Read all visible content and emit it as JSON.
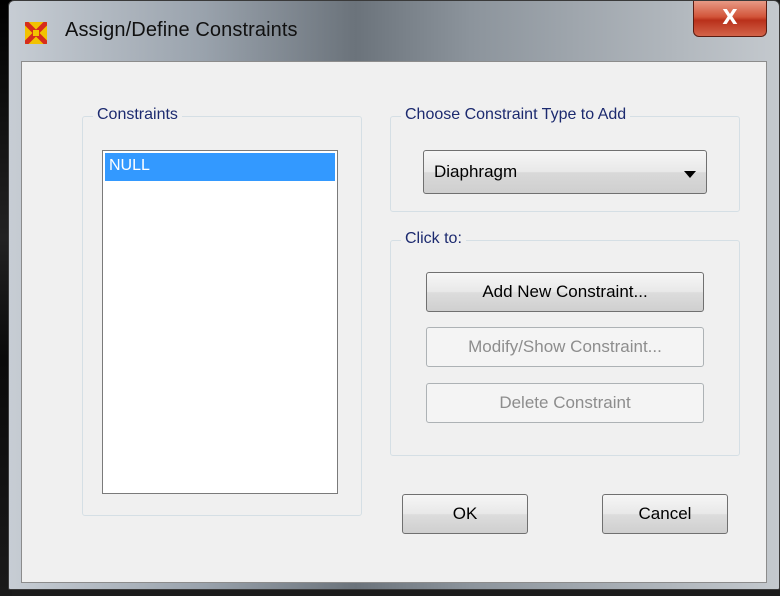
{
  "window": {
    "title": "Assign/Define Constraints",
    "close_label": "X"
  },
  "constraints_group": {
    "label": "Constraints",
    "items": [
      {
        "label": "NULL",
        "selected": true
      }
    ]
  },
  "type_group": {
    "label": "Choose Constraint Type to Add",
    "selected_type": "Diaphragm"
  },
  "click_group": {
    "label": "Click to:",
    "add_label": "Add New Constraint...",
    "modify_label": "Modify/Show Constraint...",
    "delete_label": "Delete Constraint"
  },
  "footer": {
    "ok_label": "OK",
    "cancel_label": "Cancel"
  },
  "icons": {
    "app_icon": "sap2000-app-icon",
    "close_icon": "close-icon",
    "dropdown_icon": "chevron-down-icon"
  },
  "colors": {
    "selection": "#3399ff",
    "group_label": "#1c2a6f",
    "close_button": "#c8452b"
  }
}
